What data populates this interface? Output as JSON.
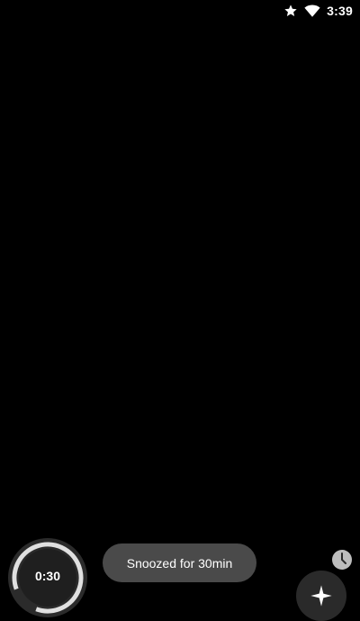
{
  "status_bar": {
    "time": "3:39",
    "icons": [
      "star-icon",
      "wifi-icon"
    ]
  },
  "timer": {
    "value": "0:30"
  },
  "toast": {
    "message": "Snoozed for 30min"
  },
  "icons": {
    "clock_badge": "clock-icon",
    "fab": "sparkle-icon"
  },
  "colors": {
    "background": "#000000",
    "toast_background": "#4a4a4a",
    "dial_ring": "#e0e0e0",
    "dial_background": "#2b2b2b"
  }
}
